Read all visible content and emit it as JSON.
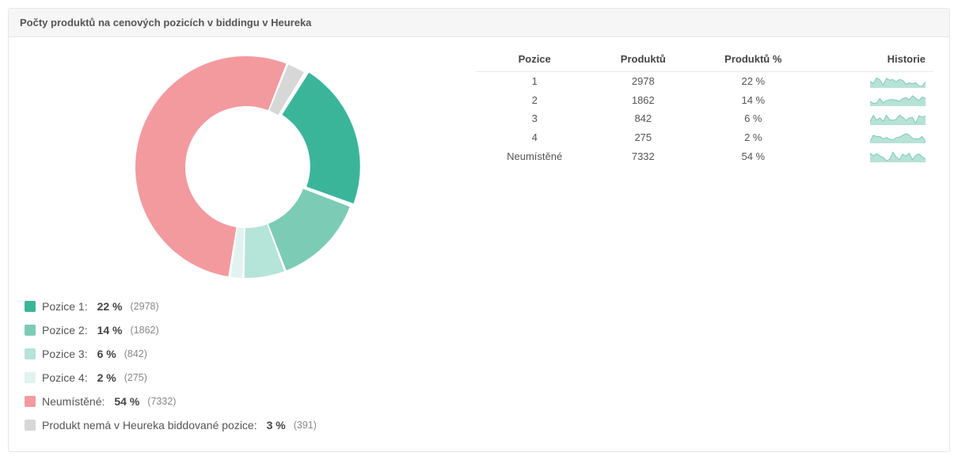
{
  "title": "Počty produktů na cenových pozicích v biddingu v Heureka",
  "colors": {
    "pos1": "#3bb59a",
    "pos2": "#7ccbb5",
    "pos3": "#b5e4d8",
    "pos4": "#e1f3ee",
    "unplaced": "#f39a9f",
    "nobid": "#d7d7d7"
  },
  "legend": [
    {
      "label": "Pozice 1:",
      "pct": "22 %",
      "count": "(2978)",
      "color": "#3bb59a"
    },
    {
      "label": "Pozice 2:",
      "pct": "14 %",
      "count": "(1862)",
      "color": "#7ccbb5"
    },
    {
      "label": "Pozice 3:",
      "pct": "6 %",
      "count": "(842)",
      "color": "#b5e4d8"
    },
    {
      "label": "Pozice 4:",
      "pct": "2 %",
      "count": "(275)",
      "color": "#e1f3ee"
    },
    {
      "label": "Neumístěné:",
      "pct": "54 %",
      "count": "(7332)",
      "color": "#f39a9f"
    },
    {
      "label": "Produkt nemá v Heureka biddované pozice:",
      "pct": "3 %",
      "count": "(391)",
      "color": "#d7d7d7"
    }
  ],
  "table": {
    "headers": {
      "pos": "Pozice",
      "count": "Produktů",
      "pct": "Produktů %",
      "hist": "Historie"
    },
    "rows": [
      {
        "pos": "1",
        "count": "2978",
        "pct": "22 %"
      },
      {
        "pos": "2",
        "count": "1862",
        "pct": "14 %"
      },
      {
        "pos": "3",
        "count": "842",
        "pct": "6 %"
      },
      {
        "pos": "4",
        "count": "275",
        "pct": "2 %"
      },
      {
        "pos": "Neumístěné",
        "count": "7332",
        "pct": "54 %"
      }
    ]
  },
  "chart_data": {
    "type": "pie",
    "title": "Počty produktů na cenových pozicích v biddingu v Heureka",
    "series": [
      {
        "name": "Pozice 1",
        "value": 2978,
        "pct": 22,
        "color": "#3bb59a"
      },
      {
        "name": "Pozice 2",
        "value": 1862,
        "pct": 14,
        "color": "#7ccbb5"
      },
      {
        "name": "Pozice 3",
        "value": 842,
        "pct": 6,
        "color": "#b5e4d8"
      },
      {
        "name": "Pozice 4",
        "value": 275,
        "pct": 2,
        "color": "#e1f3ee"
      },
      {
        "name": "Neumístěné",
        "value": 7332,
        "pct": 54,
        "color": "#f39a9f"
      },
      {
        "name": "Produkt nemá v Heureka biddované pozice",
        "value": 391,
        "pct": 3,
        "color": "#d7d7d7"
      }
    ],
    "donut": true,
    "inner_radius_ratio": 0.55,
    "start_angle_deg": 32,
    "gap_deg": 1.2
  }
}
